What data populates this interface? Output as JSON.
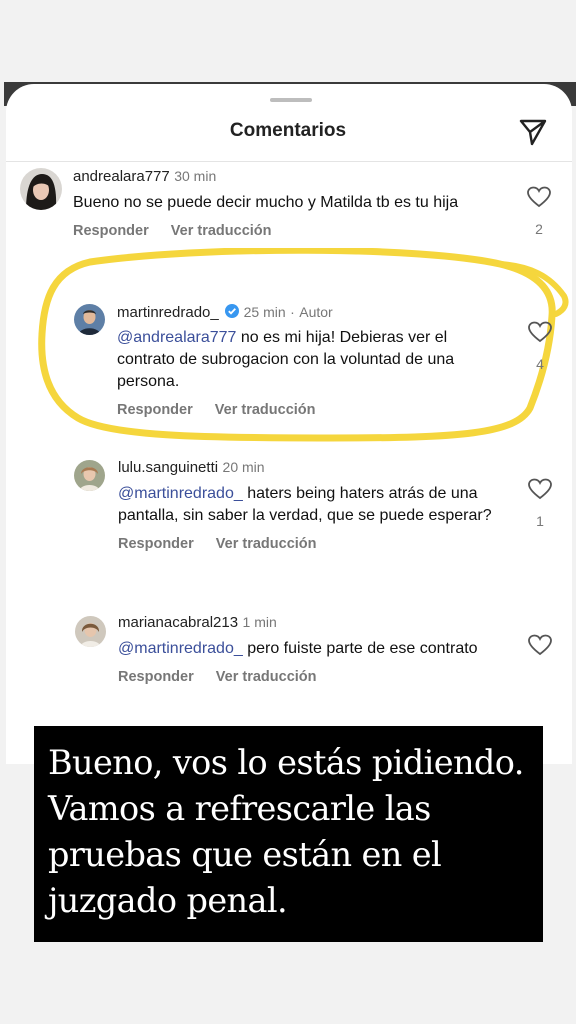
{
  "header": {
    "title": "Comentarios"
  },
  "comments": [
    {
      "username": "andrealara777",
      "time": "30 min",
      "text": "Bueno no se puede decir mucho y Matilda tb es tu hija",
      "reply": "Responder",
      "translate": "Ver traducción",
      "likes": "2"
    },
    {
      "username": "martinredrado_",
      "time": "25 min",
      "author_tag": "Autor",
      "mention": "@andrealara777",
      "text": " no es mi hija! Debieras ver el contrato de subrogacion con la voluntad de una persona.",
      "reply": "Responder",
      "translate": "Ver traducción",
      "likes": "4"
    },
    {
      "username": "lulu.sanguinetti",
      "time": "20 min",
      "mention": "@martinredrado_",
      "text": " haters being haters atrás de una pantalla, sin saber la verdad, que se puede esperar?",
      "reply": "Responder",
      "translate": "Ver traducción",
      "likes": "1"
    },
    {
      "username": "marianacabral213",
      "time": "1 min",
      "mention": "@martinredrado_",
      "text": " pero fuiste parte de ese contrato",
      "reply": "Responder",
      "translate": "Ver traducción"
    }
  ],
  "overlay_caption": "Bueno, vos lo estás pidiendo. Vamos a refrescarle las pruebas que están en el juzgado penal.",
  "colors": {
    "highlight": "#f5d63d",
    "mention": "#3b4f9a",
    "verified": "#3897f0"
  },
  "icons": [
    "send-icon",
    "heart-icon",
    "verified-badge-icon"
  ]
}
